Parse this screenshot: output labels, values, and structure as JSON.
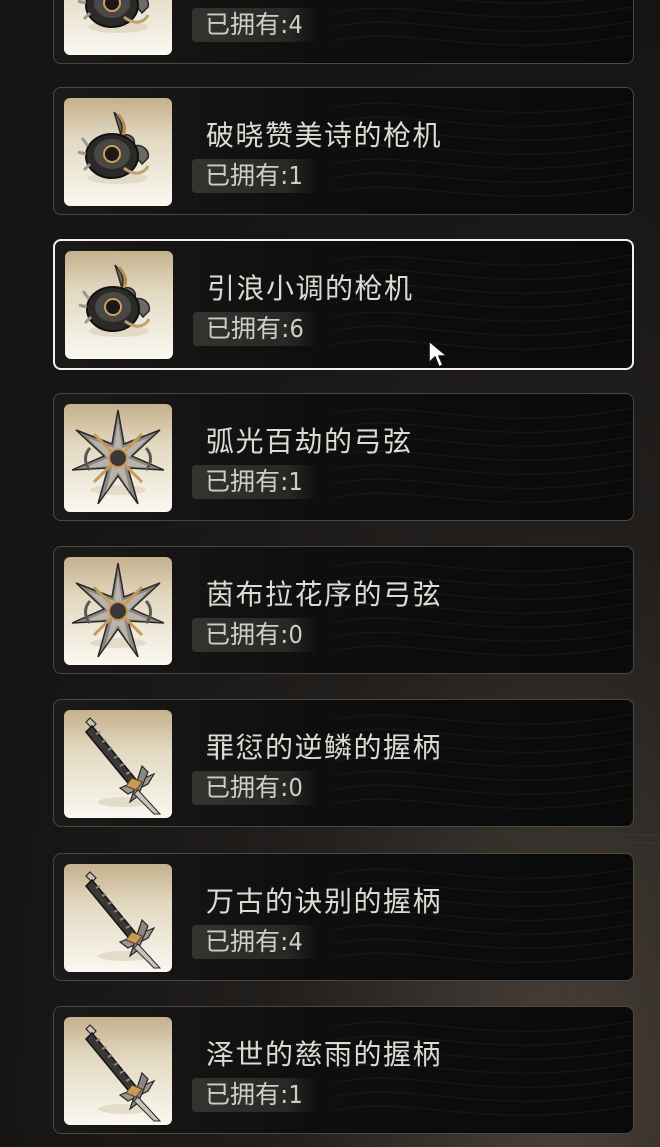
{
  "items": [
    {
      "name": "",
      "owned_label": "已拥有:",
      "owned_count": "4",
      "icon": "trigger-mechanism-icon",
      "selected": false
    },
    {
      "name": "破晓赞美诗的枪机",
      "owned_label": "已拥有:",
      "owned_count": "1",
      "icon": "trigger-mechanism-icon",
      "selected": false
    },
    {
      "name": "引浪小调的枪机",
      "owned_label": "已拥有:",
      "owned_count": "6",
      "icon": "trigger-mechanism-icon",
      "selected": true
    },
    {
      "name": "弧光百劫的弓弦",
      "owned_label": "已拥有:",
      "owned_count": "1",
      "icon": "bowstring-star-icon",
      "selected": false
    },
    {
      "name": "茵布拉花序的弓弦",
      "owned_label": "已拥有:",
      "owned_count": "0",
      "icon": "bowstring-star-icon",
      "selected": false
    },
    {
      "name": "罪愆的逆鳞的握柄",
      "owned_label": "已拥有:",
      "owned_count": "0",
      "icon": "sword-hilt-icon",
      "selected": false
    },
    {
      "name": "万古的诀别的握柄",
      "owned_label": "已拥有:",
      "owned_count": "4",
      "icon": "sword-hilt-icon",
      "selected": false
    },
    {
      "name": "泽世的慈雨的握柄",
      "owned_label": "已拥有:",
      "owned_count": "1",
      "icon": "sword-hilt-icon",
      "selected": false
    }
  ],
  "colors": {
    "accent_border": "#f2f0ec",
    "card_border": "#4a4844",
    "text": "#dcdad3",
    "thumb_bg": "#faf8f1"
  },
  "cursor_icon": "pointer-cursor-icon"
}
